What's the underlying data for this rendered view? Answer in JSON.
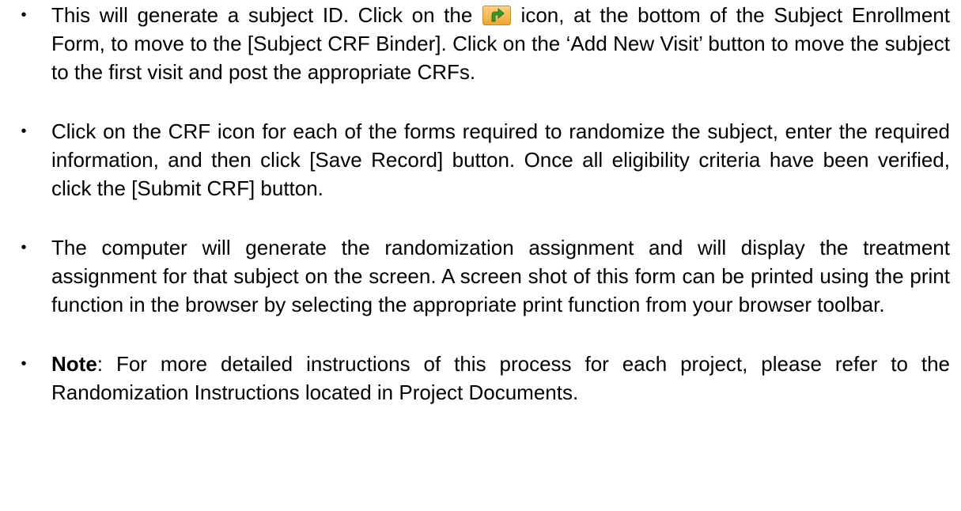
{
  "bullet_char": "•",
  "items": [
    {
      "before_icon": "This will generate a subject ID.  Click on the ",
      "icon": "green-arrow-icon",
      "after_icon": " icon, at the bottom of the Subject Enrollment Form, to move to the [Subject CRF Binder].  Click on the ‘Add New Visit’ button to move the subject to the first visit and post the appropriate CRFs."
    },
    {
      "text": "Click on the CRF icon for each of the forms required to randomize the subject, enter the required information, and then click [Save Record] button. Once all eligibility criteria have been verified, click the [Submit CRF] button."
    },
    {
      "text": "The computer will generate the randomization assignment and will display the treatment assignment for that subject on the screen.  A screen shot of this form can be printed using the print function in the browser by selecting the appropriate print function from your browser toolbar."
    },
    {
      "bold": "Note",
      "text": ": For more detailed instructions of this process for each project, please refer to the Randomization Instructions located in Project Documents."
    }
  ],
  "icon_colors": {
    "background_top": "#ffd27a",
    "background_bottom": "#f0a531",
    "arrow": "#2e9a2e"
  }
}
